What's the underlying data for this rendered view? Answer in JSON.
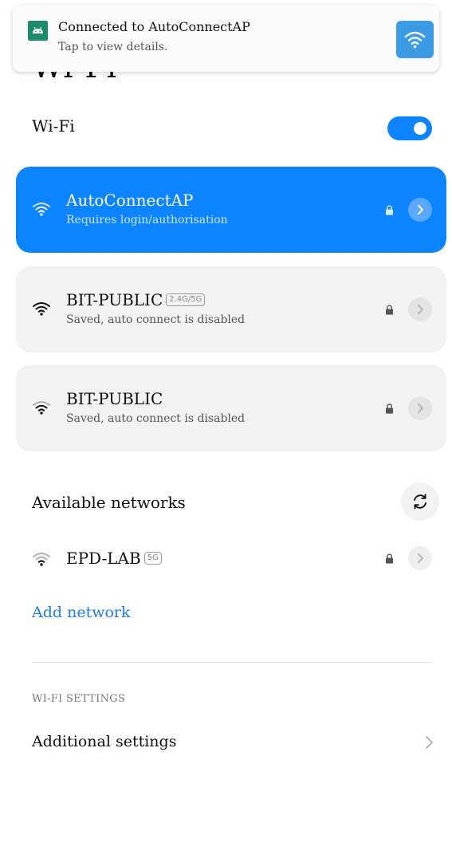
{
  "page": {
    "title": "Wi-Fi"
  },
  "notification": {
    "title": "Connected to AutoConnectAP",
    "text": "Tap to view details.",
    "app_icon": "android-icon",
    "action_icon": "wifi-icon",
    "accent": "#3b9be3"
  },
  "wifi_toggle": {
    "label": "Wi-Fi",
    "state": "on",
    "accent": "#0d84ff"
  },
  "saved_networks": [
    {
      "name": "AutoConnectAP",
      "badge": "",
      "status": "Requires login/authorisation",
      "secured": true,
      "active": true
    },
    {
      "name": "BIT-PUBLIC",
      "badge": "2.4G/5G",
      "status": "Saved, auto connect is disabled",
      "secured": true,
      "active": false
    },
    {
      "name": "BIT-PUBLIC",
      "badge": "",
      "status": "Saved, auto connect is disabled",
      "secured": true,
      "active": false
    }
  ],
  "available": {
    "title": "Available networks",
    "refresh_icon": "refresh-icon",
    "networks": [
      {
        "name": "EPD-LAB",
        "badge": "5G",
        "secured": true
      }
    ]
  },
  "add_network": {
    "label": "Add network"
  },
  "settings": {
    "header": "WI-FI SETTINGS",
    "additional_label": "Additional settings"
  }
}
